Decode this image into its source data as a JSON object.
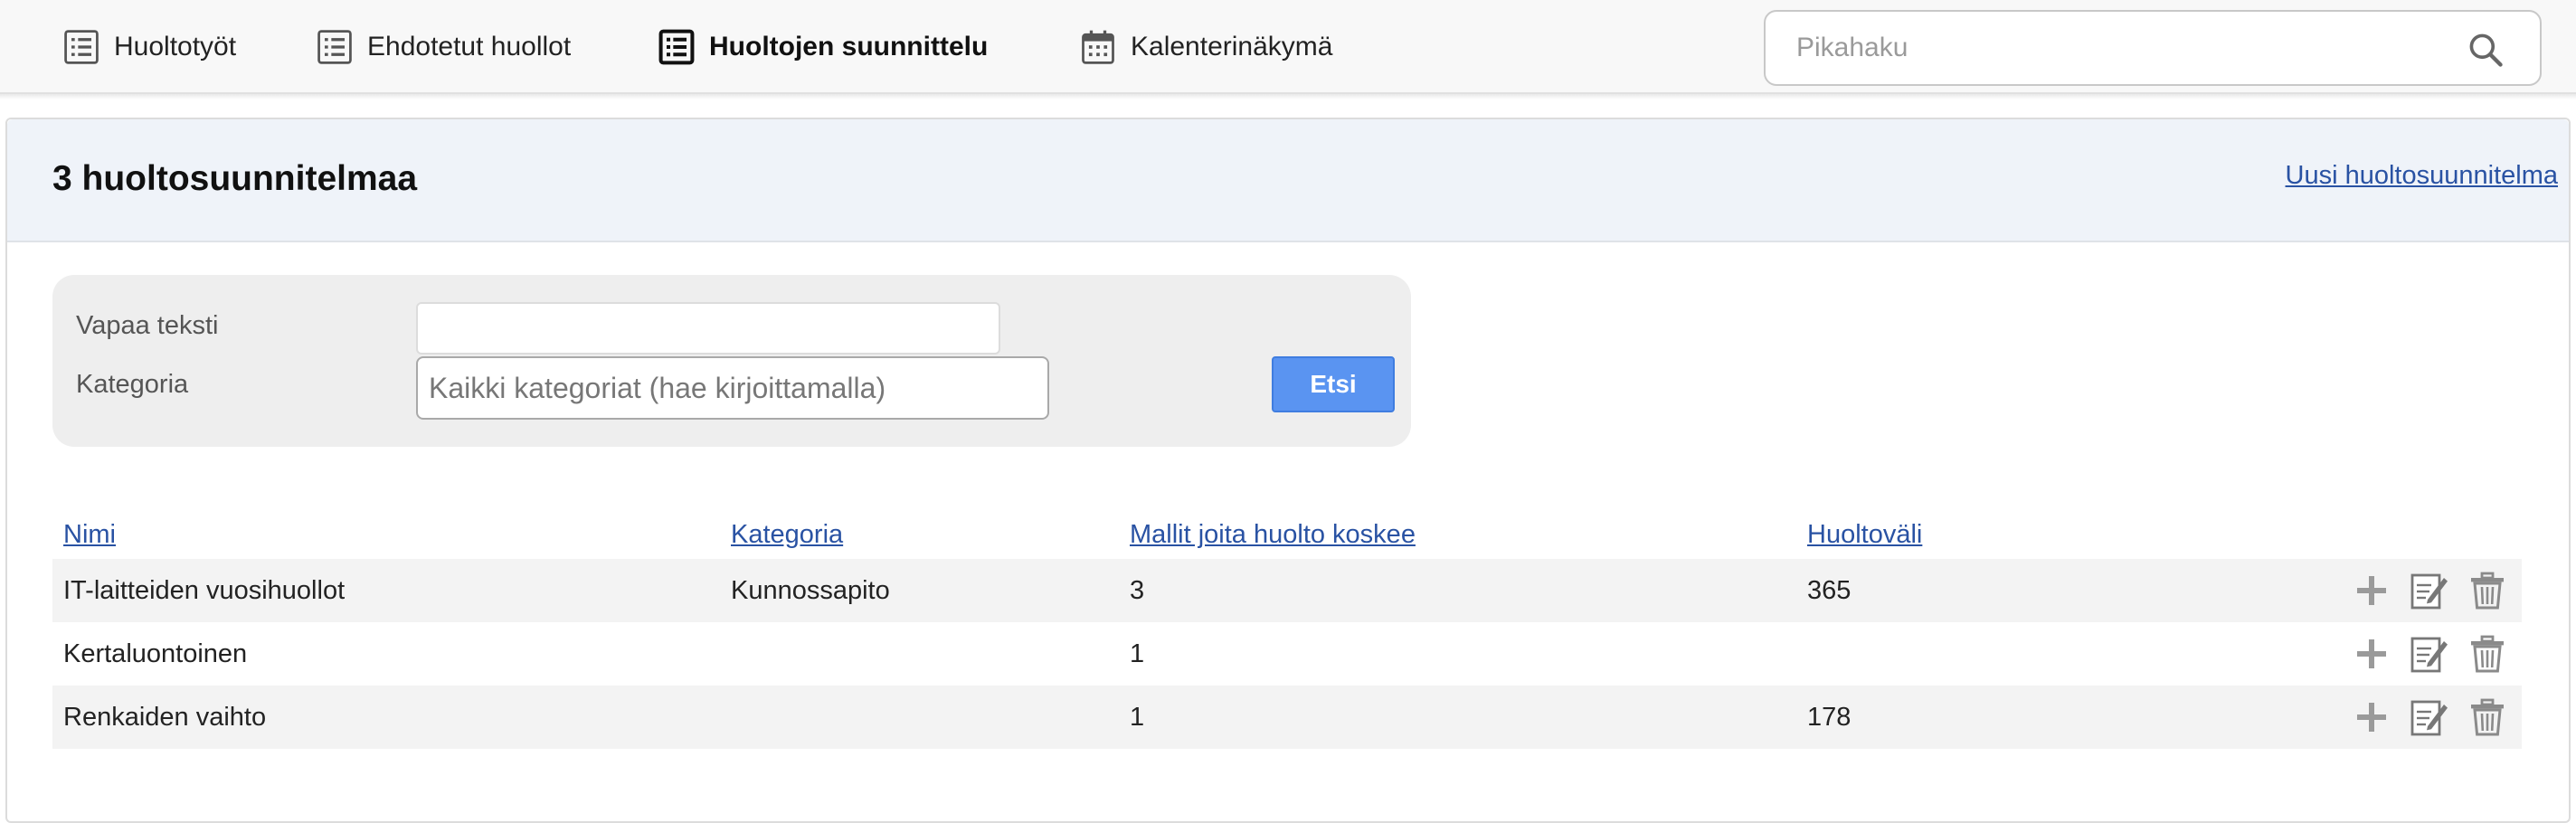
{
  "nav": {
    "items": [
      {
        "label": "Huoltotyöt",
        "icon": "list-icon",
        "active": false
      },
      {
        "label": "Ehdotetut huollot",
        "icon": "list-icon",
        "active": false
      },
      {
        "label": "Huoltojen suunnittelu",
        "icon": "list-icon",
        "active": true
      },
      {
        "label": "Kalenterinäkymä",
        "icon": "calendar-icon",
        "active": false
      }
    ],
    "search_placeholder": "Pikahaku",
    "search_icon": "search-icon"
  },
  "page": {
    "title": "3 huoltosuunnitelmaa",
    "new_link": "Uusi huoltosuunnitelma"
  },
  "filter": {
    "free_text_label": "Vapaa teksti",
    "free_text_value": "",
    "category_label": "Kategoria",
    "category_placeholder": "Kaikki kategoriat (hae kirjoittamalla)",
    "search_button": "Etsi"
  },
  "table": {
    "columns": [
      "Nimi",
      "Kategoria",
      "Mallit joita huolto koskee",
      "Huoltoväli"
    ],
    "rows": [
      {
        "name": "IT-laitteiden vuosihuollot",
        "category": "Kunnossapito",
        "models": "3",
        "interval": "365"
      },
      {
        "name": "Kertaluontoinen",
        "category": "",
        "models": "1",
        "interval": ""
      },
      {
        "name": "Renkaiden vaihto",
        "category": "",
        "models": "1",
        "interval": "178"
      }
    ],
    "row_actions": [
      "plus-icon",
      "edit-icon",
      "trash-icon"
    ]
  },
  "colors": {
    "link": "#2952a3",
    "button": "#5a94f1",
    "header_bg": "#eff3f9"
  }
}
